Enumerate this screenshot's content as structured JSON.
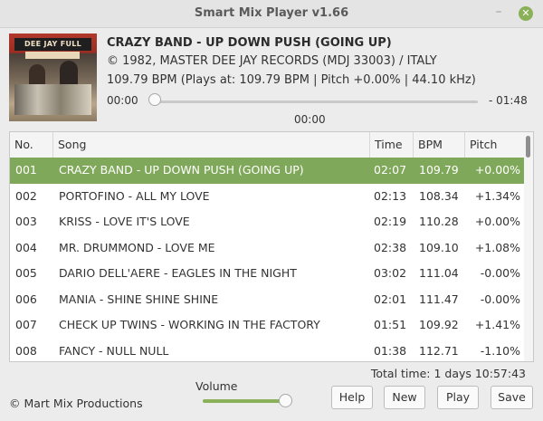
{
  "window": {
    "title": "Smart Mix Player v1.66"
  },
  "now_playing": {
    "cover_text": "DEE JAY FULL TIME",
    "title": "CRAZY BAND - UP DOWN PUSH (GOING UP)",
    "label": "© 1982, MASTER DEE JAY RECORDS (MDJ 33003) / ITALY",
    "bpm_info": "109.79 BPM (Plays at: 109.79 BPM | Pitch +0.00% | 44.10 kHz)",
    "elapsed": "00:00",
    "remaining": "- 01:48",
    "position": "00:00",
    "progress": 0
  },
  "table": {
    "headers": {
      "no": "No.",
      "song": "Song",
      "time": "Time",
      "bpm": "BPM",
      "pitch": "Pitch"
    },
    "rows": [
      {
        "no": "001",
        "song": "CRAZY BAND - UP DOWN PUSH (GOING UP)",
        "time": "02:07",
        "bpm": "109.79",
        "pitch": "+0.00%"
      },
      {
        "no": "002",
        "song": "PORTOFINO - ALL MY LOVE",
        "time": "02:13",
        "bpm": "108.34",
        "pitch": "+1.34%"
      },
      {
        "no": "003",
        "song": "KRISS - LOVE IT'S LOVE",
        "time": "02:19",
        "bpm": "110.28",
        "pitch": "+0.00%"
      },
      {
        "no": "004",
        "song": "MR. DRUMMOND - LOVE ME",
        "time": "02:38",
        "bpm": "109.10",
        "pitch": "+1.08%"
      },
      {
        "no": "005",
        "song": "DARIO DELL'AERE - EAGLES IN THE NIGHT",
        "time": "03:02",
        "bpm": "111.04",
        "pitch": "-0.00%"
      },
      {
        "no": "006",
        "song": "MANIA - SHINE SHINE SHINE",
        "time": "02:01",
        "bpm": "111.47",
        "pitch": "-0.00%"
      },
      {
        "no": "007",
        "song": "CHECK UP TWINS - WORKING IN THE FACTORY",
        "time": "01:51",
        "bpm": "109.92",
        "pitch": "+1.41%"
      },
      {
        "no": "008",
        "song": "FANCY - NULL NULL",
        "time": "01:38",
        "bpm": "112.71",
        "pitch": "-1.10%"
      }
    ]
  },
  "footer": {
    "total_time": "Total time: 1 days 10:57:43",
    "copyright": "© Mart Mix Productions",
    "volume_label": "Volume",
    "volume_level": 1.0,
    "buttons": {
      "help": "Help",
      "new": "New",
      "play": "Play",
      "save": "Save"
    }
  },
  "colors": {
    "accent": "#80a85a",
    "close": "#8bb158"
  },
  "icons": {
    "minimize": "minimize-icon",
    "close": "close-icon"
  }
}
